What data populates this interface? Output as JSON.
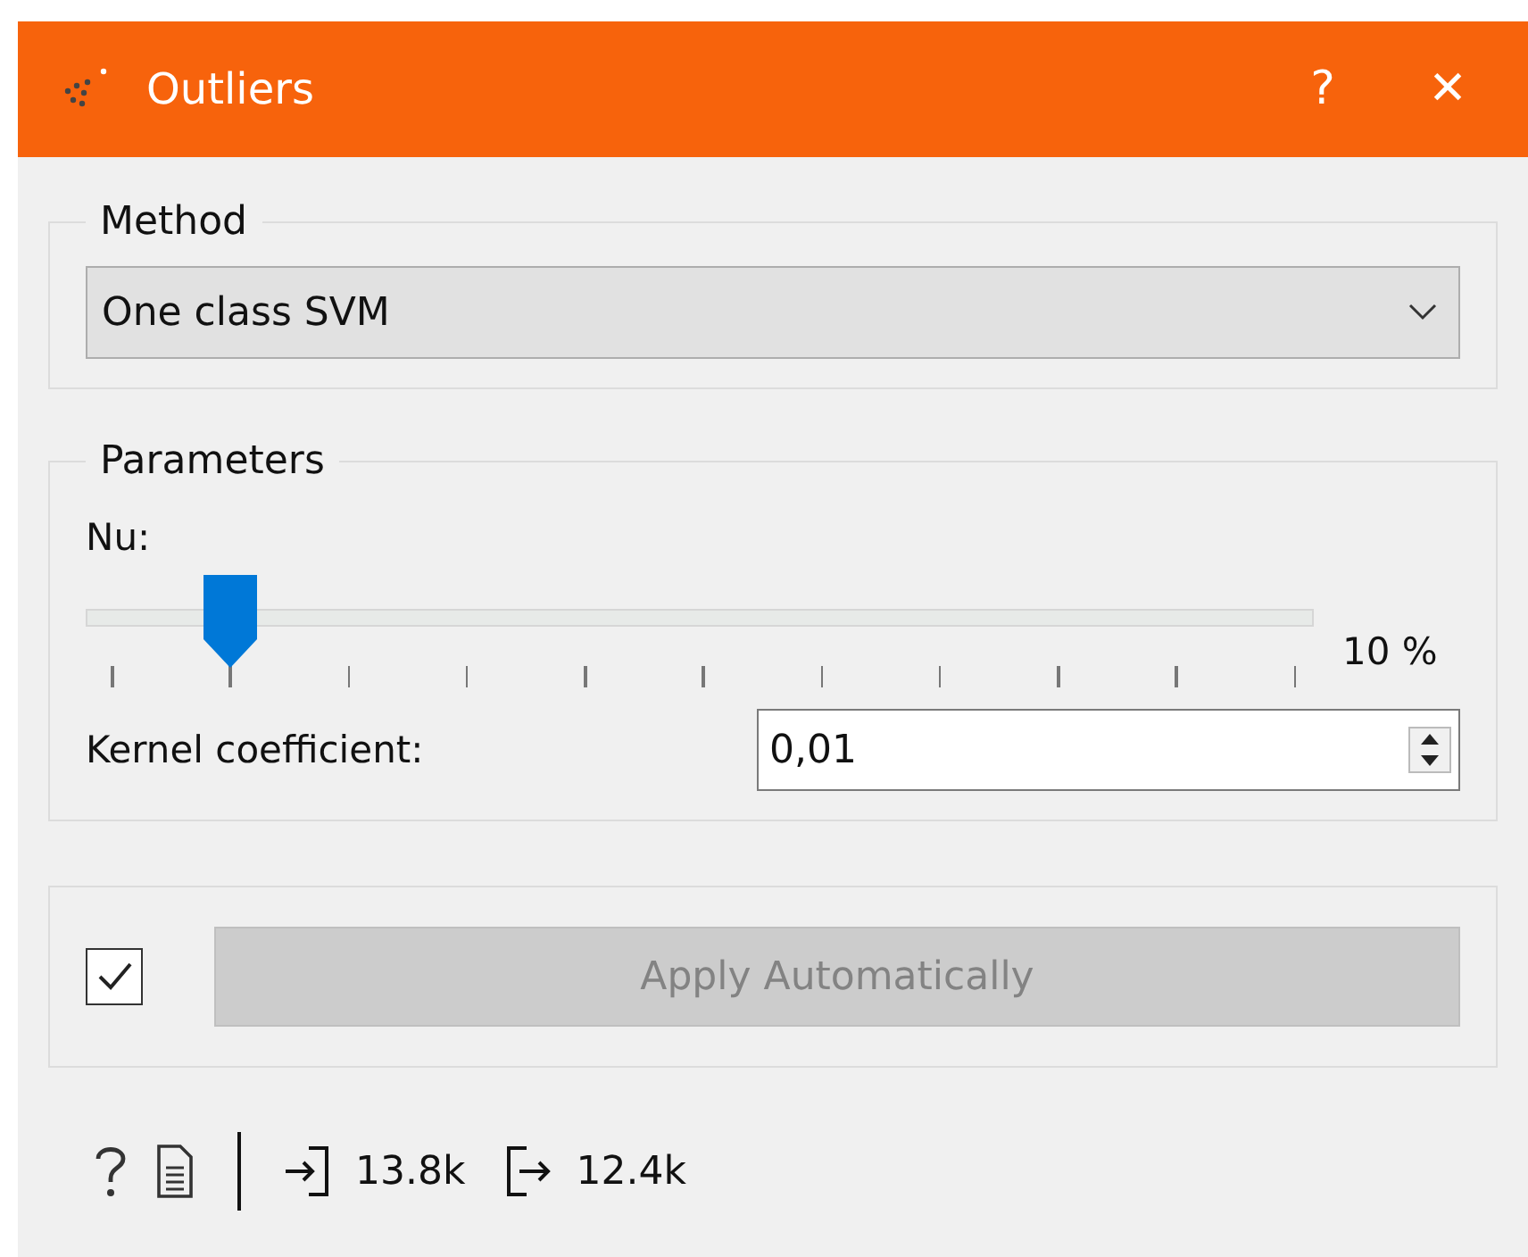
{
  "window": {
    "title": "Outliers",
    "help": "?",
    "close": "✕"
  },
  "method": {
    "legend": "Method",
    "value": "One class SVM"
  },
  "parameters": {
    "legend": "Parameters",
    "nu_label": "Nu:",
    "nu": {
      "level": 0.1,
      "reading": "10 %"
    },
    "kernel_label": "Kernel coefficient:",
    "kernel_value": "0,01"
  },
  "apply": {
    "checked": true,
    "label": "Apply Automatically",
    "disabled": true
  },
  "status_bar": {
    "input_count": "13.8k",
    "output_count": "12.4k"
  }
}
